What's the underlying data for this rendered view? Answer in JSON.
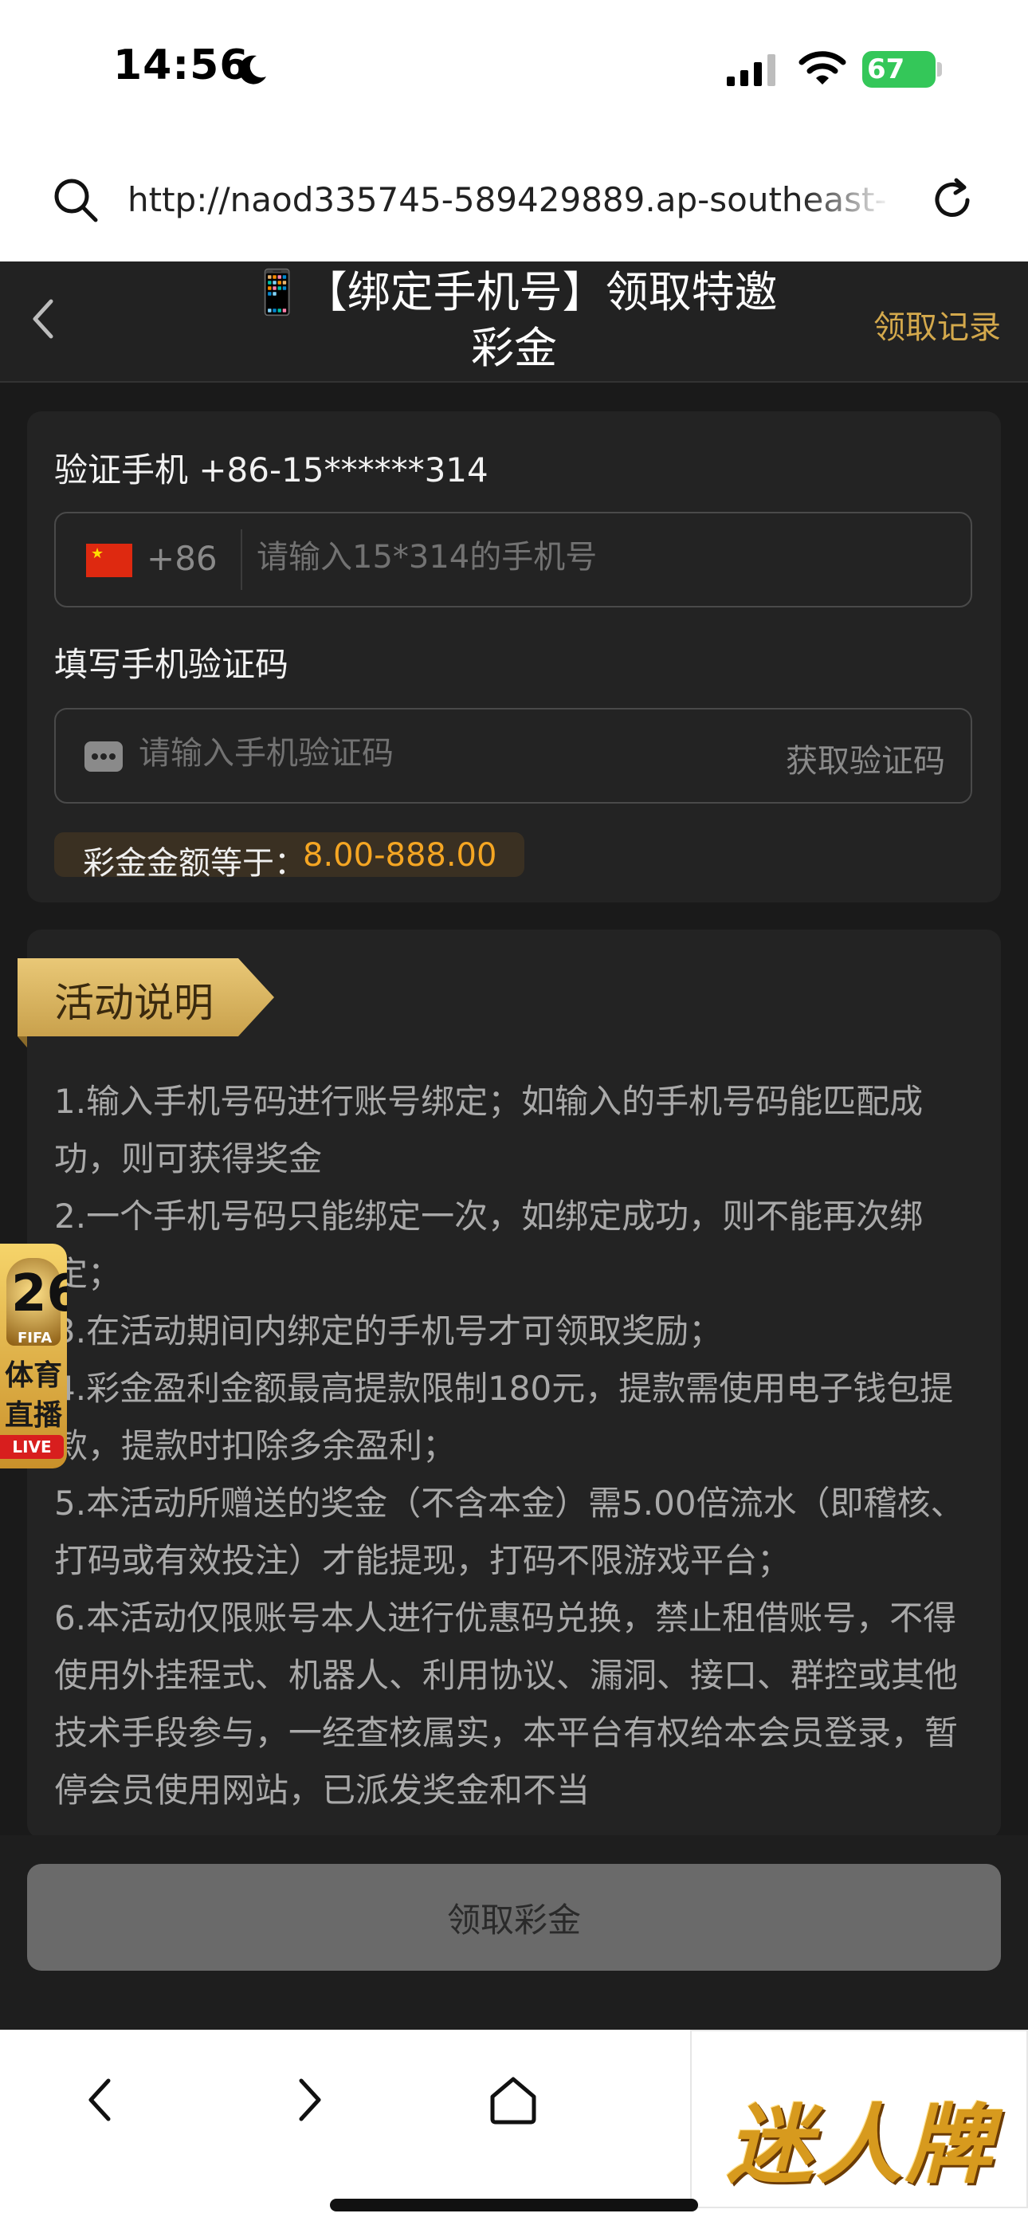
{
  "status_bar": {
    "time": "14:56",
    "battery": "67"
  },
  "browser": {
    "url": "http://naod335745-589429889.ap-southeast-"
  },
  "header": {
    "title": "📱【绑定手机号】领取特邀彩金",
    "record_label": "领取记录"
  },
  "form": {
    "verify_label": "验证手机 +86-15******314",
    "country_code": "+86",
    "phone_placeholder": "请输入15*314的手机号",
    "code_label": "填写手机验证码",
    "code_placeholder": "请输入手机验证码",
    "get_code_label": "获取验证码",
    "amount_label": "彩金金额等于：",
    "amount_value": "8.00-888.00"
  },
  "activity": {
    "section_title": "活动说明",
    "rules": [
      "1.输入手机号码进行账号绑定；如输入的手机号码能匹配成功，则可获得奖金",
      "2.一个手机号码只能绑定一次，如绑定成功，则不能再次绑定；",
      "3.在活动期间内绑定的手机号才可领取奖励；",
      "4.彩金盈利金额最高提款限制180元，提款需使用电子钱包提款，提款时扣除多余盈利；",
      "5.本活动所赠送的奖金（不含本金）需5.00倍流水（即稽核、打码或有效投注）才能提现，打码不限游戏平台；",
      "6.本活动仅限账号本人进行优惠码兑换，禁止租借账号，不得使用外挂程式、机器人、利用协议、漏洞、接口、群控或其他技术手段参与，一经查核属实，本平台有权给本会员登录，暂停会员使用网站，已派发奖金和不当"
    ]
  },
  "float_badge": {
    "number": "26",
    "fifa": "FIFA",
    "line1": "体育",
    "line2": "直播",
    "live": "LIVE"
  },
  "claim_button": "领取彩金",
  "brand": {
    "text": "迷人牌"
  },
  "icons": [
    "moon-icon",
    "signal-icon",
    "wifi-icon",
    "search-icon",
    "reload-icon",
    "chevron-left-icon",
    "china-flag-icon",
    "message-dots-icon",
    "nav-back-icon",
    "nav-forward-icon",
    "home-icon"
  ],
  "colors": {
    "accent_gold": "#d4a94c",
    "amount_orange": "#f5a623",
    "background": "#1a1a1a",
    "card": "#232323",
    "button_disabled": "#6a6a6a"
  }
}
